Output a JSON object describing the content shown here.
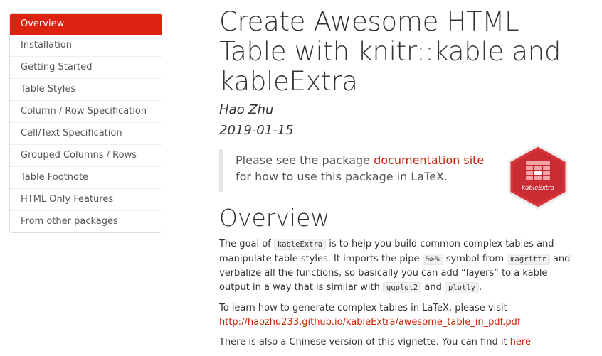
{
  "toc": {
    "items": [
      {
        "label": "Overview",
        "active": true
      },
      {
        "label": "Installation"
      },
      {
        "label": "Getting Started"
      },
      {
        "label": "Table Styles"
      },
      {
        "label": "Column / Row Specification"
      },
      {
        "label": "Cell/Text Specification"
      },
      {
        "label": "Grouped Columns / Rows"
      },
      {
        "label": "Table Footnote"
      },
      {
        "label": "HTML Only Features"
      },
      {
        "label": "From other packages"
      }
    ]
  },
  "header": {
    "title": "Create Awesome HTML Table with knitr::kable and kableExtra",
    "author": "Hao Zhu",
    "date": "2019-01-15"
  },
  "callout": {
    "before": "Please see the package ",
    "link": "documentation site",
    "after": " for how to use this package in LaTeX."
  },
  "logo": {
    "text": "kableExtra",
    "color": "#d9343a"
  },
  "overview": {
    "heading": "Overview",
    "p1": {
      "t1": "The goal of ",
      "c1": "kableExtra",
      "t2": " is to help you build common complex tables and manipulate table styles. It imports the pipe ",
      "c2": "%>%",
      "t3": " symbol from ",
      "c3": "magrittr",
      "t4": " and verbalize all the functions, so basically you can add “layers” to a kable output in a way that is similar with ",
      "c4": "ggplot2",
      "t5": " and ",
      "c5": "plotly",
      "t6": "."
    },
    "p2": {
      "text": "To learn how to generate complex tables in LaTeX, please visit ",
      "link": "http://haozhu233.github.io/kableExtra/awesome_table_in_pdf.pdf"
    },
    "p3": {
      "text": "There is also a Chinese version of this vignette. You can find it ",
      "link": "here"
    }
  },
  "colors": {
    "accent": "#dd2211",
    "link": "#cc2200"
  }
}
